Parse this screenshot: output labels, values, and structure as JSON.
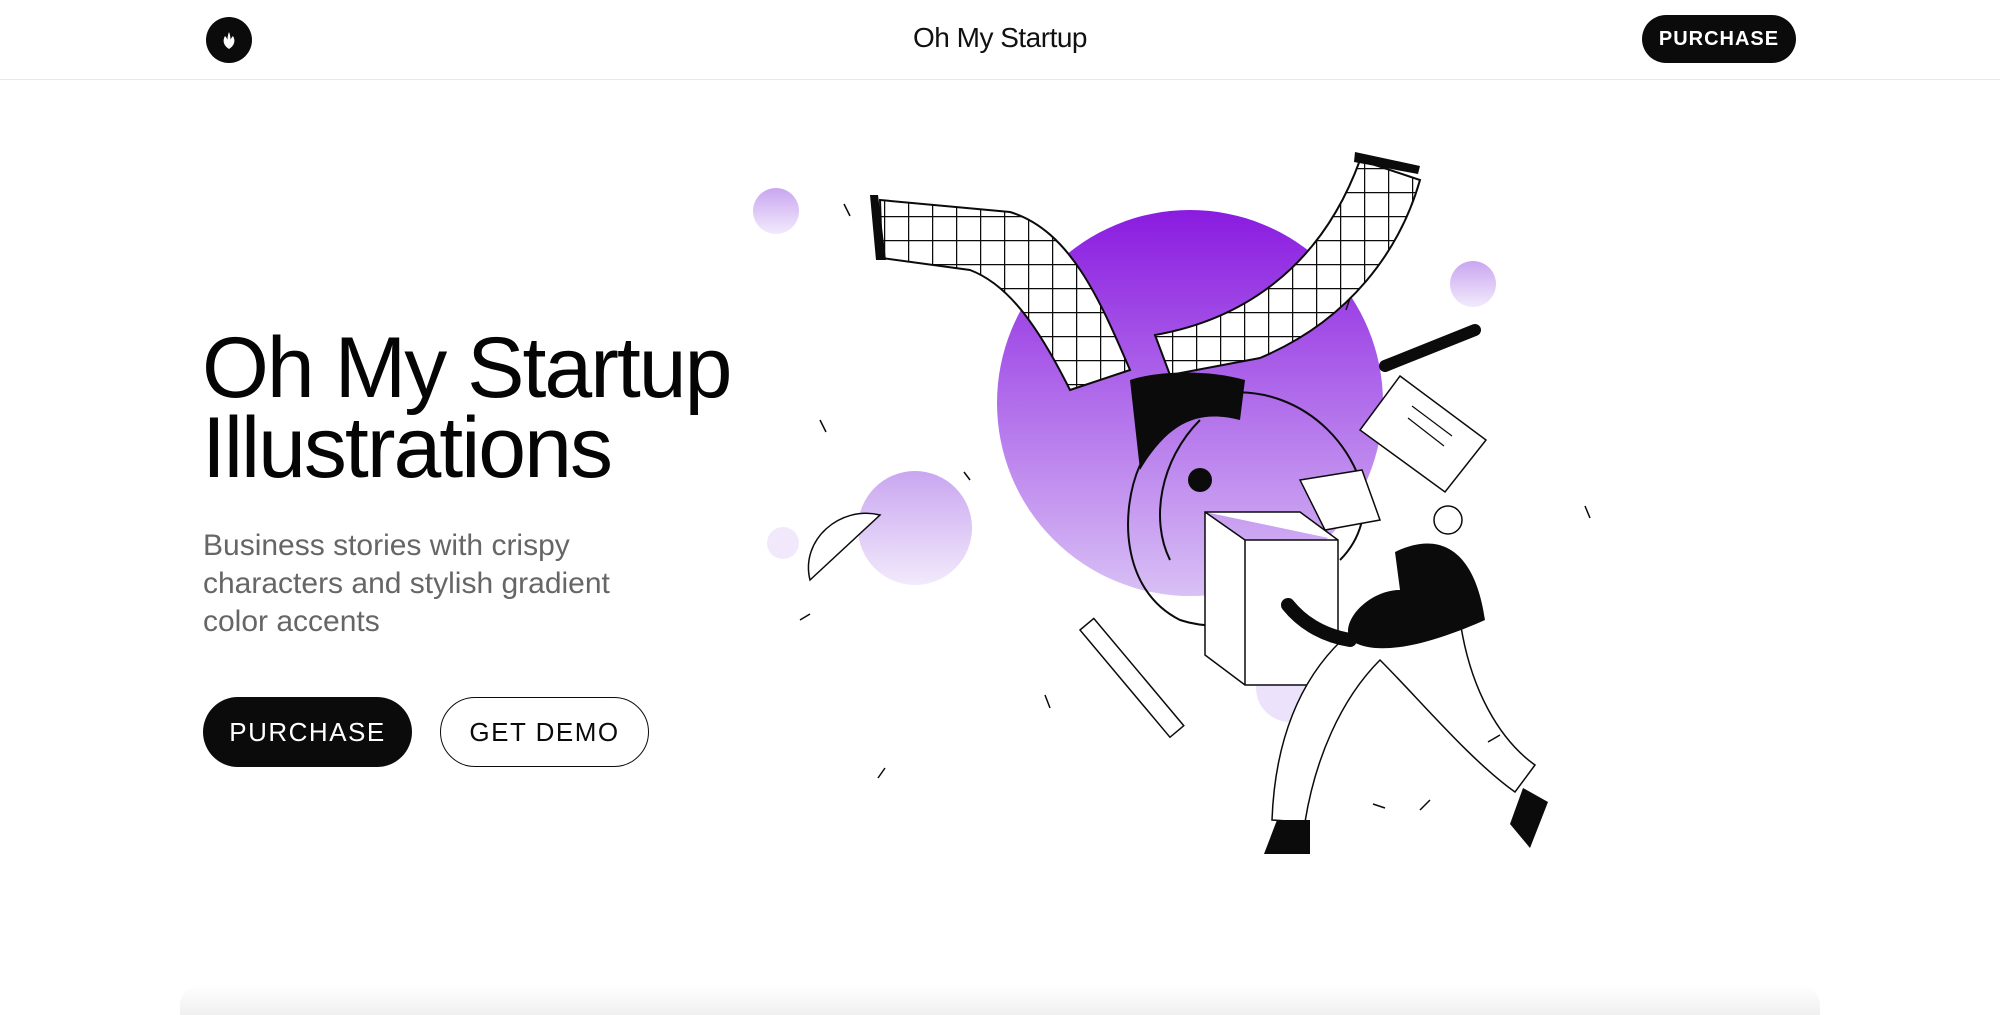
{
  "header": {
    "brand": "Oh My Startup",
    "logo_icon": "leaf-icon",
    "purchase_label": "PURCHASE"
  },
  "hero": {
    "title_line1": "Oh My Startup",
    "title_line2": "Illustrations",
    "subtitle_line1": "Business stories with crispy",
    "subtitle_line2": "characters and stylish gradient",
    "subtitle_line3": "color accents",
    "purchase_label": "PURCHASE",
    "demo_label": "GET DEMO"
  },
  "colors": {
    "accent": "#8a2be2",
    "accent_light": "#e6d6f8",
    "dark": "#0b0b0b"
  }
}
